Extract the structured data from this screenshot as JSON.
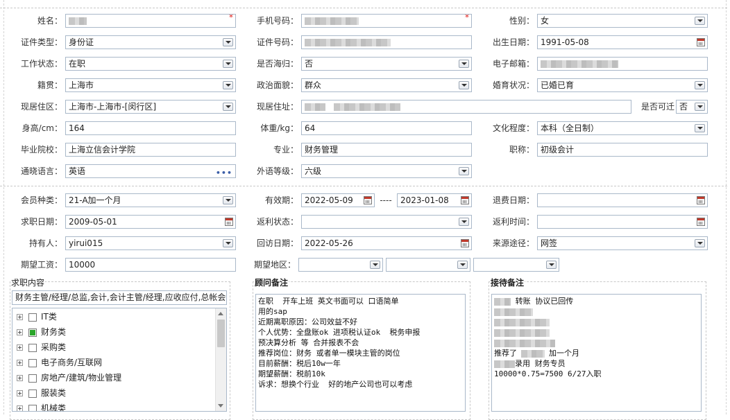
{
  "form": {
    "name_label": "姓名：",
    "phone_label": "手机号码：",
    "gender_label": "性别：",
    "gender_value": "女",
    "idtype_label": "证件类型：",
    "idtype_value": "身份证",
    "idno_label": "证件号码：",
    "birth_label": "出生日期：",
    "birth_value": "1991-05-08",
    "work_label": "工作状态：",
    "work_value": "在职",
    "returnee_label": "是否海归：",
    "returnee_value": "否",
    "email_label": "电子邮箱：",
    "native_label": "籍贯：",
    "native_value": "上海市",
    "political_label": "政治面貌：",
    "political_value": "群众",
    "marital_label": "婚育状况：",
    "marital_value": "已婚已育",
    "residence_area_label": "现居住区：",
    "residence_area_value": "上海市-上海市-[闵行区]",
    "address_label": "现居住址：",
    "relocate_label": "是否可迁",
    "relocate_value": "否",
    "height_label": "身高/cm：",
    "height_value": "164",
    "weight_label": "体重/kg：",
    "weight_value": "64",
    "education_label": "文化程度：",
    "education_value": "本科（全日制）",
    "school_label": "毕业院校：",
    "school_value": "上海立信会计学院",
    "major_label": "专业：",
    "major_value": "财务管理",
    "title_label": "职称：",
    "title_value": "初级会计",
    "language_label": "通晓语言：",
    "language_value": "英语",
    "foreign_level_label": "外语等级：",
    "foreign_level_value": "六级",
    "dots": "•••"
  },
  "member": {
    "type_label": "会员种类：",
    "type_value": "21-A加一个月",
    "valid_label": "有效期：",
    "valid_from": "2022-05-09",
    "valid_sep": "----",
    "valid_to": "2023-01-08",
    "refund_date_label": "退费日期：",
    "job_date_label": "求职日期：",
    "job_date_value": "2009-05-01",
    "rebate_status_label": "返利状态：",
    "rebate_time_label": "返利时间：",
    "holder_label": "持有人：",
    "holder_value": "yirui015",
    "visit_date_label": "回访日期：",
    "visit_date_value": "2022-05-26",
    "source_label": "来源途径：",
    "source_value": "网签",
    "salary_label": "期望工资：",
    "salary_value": "10000",
    "area_label": "期望地区："
  },
  "job_panel": {
    "title": "求职内容",
    "summary": "财务主管/经理/总监,会计,会计主管/经理,应收应付,总帐会计",
    "categories": [
      {
        "label": "IT类",
        "checked": false
      },
      {
        "label": "财务类",
        "checked": true
      },
      {
        "label": "采购类",
        "checked": false
      },
      {
        "label": "电子商务/互联网",
        "checked": false
      },
      {
        "label": "房地产/建筑/物业管理",
        "checked": false
      },
      {
        "label": "服装类",
        "checked": false
      },
      {
        "label": "机械类",
        "checked": false
      }
    ]
  },
  "consultant_panel": {
    "title": "顾问备注",
    "text": "在职  开车上班 英文书面可以 口语简单\n用的sap\n近期离职原因：公司效益不好\n个人优势：全盘账ok 进项税认证ok  税务申报\n预决算分析 等 合并报表不会\n推荐岗位：财务 或者单一模块主管的岗位\n目前薪酬：税后10w一年\n期望薪酬：税前10k\n诉求：想换个行业  好的地产公司也可以考虑"
  },
  "reception_panel": {
    "title": "接待备注",
    "line1": "转账 协议已回传",
    "line2_prefix": "推荐了",
    "line2_suffix": "加一个月",
    "line3": "录用 财务专员",
    "line4": "10000*0.75=7500  6/27入职"
  }
}
